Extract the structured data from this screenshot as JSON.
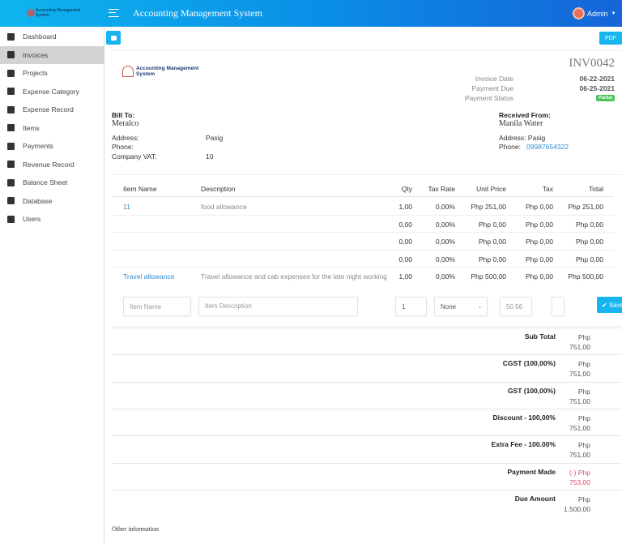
{
  "header": {
    "logo_text": "Accounting Management System",
    "title": "Accounting Management System",
    "user": "Admin"
  },
  "sidebar": {
    "items": [
      {
        "label": "Dashboard",
        "icon": "dashboard-icon"
      },
      {
        "label": "Invoices",
        "icon": "file-icon",
        "active": true
      },
      {
        "label": "Projects",
        "icon": "sitemap-icon"
      },
      {
        "label": "Expense Category",
        "icon": "search-dollar-icon"
      },
      {
        "label": "Expense Record",
        "icon": "file-invoice-icon"
      },
      {
        "label": "Items",
        "icon": "list-icon"
      },
      {
        "label": "Payments",
        "icon": "money-icon"
      },
      {
        "label": "Revenue Record",
        "icon": "filter-dollar-icon"
      },
      {
        "label": "Balance Sheet",
        "icon": "file-invoice-icon"
      },
      {
        "label": "Database",
        "icon": "database-icon"
      },
      {
        "label": "Users",
        "icon": "user-icon"
      }
    ]
  },
  "toolbar": {
    "print_icon": "print-icon",
    "pdf_label": "PDF"
  },
  "invoice": {
    "logo_text": "Accounting Management System",
    "number": "INV0042",
    "meta": [
      {
        "label": "Invoice Date",
        "value": "06-22-2021"
      },
      {
        "label": "Payment Due",
        "value": "06-25-2021"
      },
      {
        "label": "Payment Status",
        "value": "Partial"
      }
    ],
    "status_color": "#4cc45a",
    "bill_to": {
      "heading": "Bill To:",
      "name": "Meralco",
      "address_label": "Address:",
      "address": "Pasig",
      "phone_label": "Phone:",
      "phone": "",
      "vat_label": "Company VAT:",
      "vat": "10"
    },
    "received_from": {
      "heading": "Received From:",
      "name": "Manila Water",
      "address_label": "Address:",
      "address": "Pasig",
      "phone_label": "Phone:",
      "phone": "09987654322"
    },
    "columns": [
      "Item Name",
      "Description",
      "Qty",
      "Tax Rate",
      "Unit Price",
      "Tax",
      "Total"
    ],
    "rows": [
      [
        "11",
        "food allowance",
        "1,00",
        "0,00%",
        "Php 251,00",
        "Php 0,00",
        "Php 251,00"
      ],
      [
        "",
        "",
        "0,00",
        "0,00%",
        "Php 0,00",
        "Php 0,00",
        "Php 0,00"
      ],
      [
        "",
        "",
        "0,00",
        "0,00%",
        "Php 0,00",
        "Php 0,00",
        "Php 0,00"
      ],
      [
        "",
        "",
        "0,00",
        "0,00%",
        "Php 0,00",
        "Php 0,00",
        "Php 0,00"
      ],
      [
        "Travel allowance",
        "Travel allowance and cab expenses for the late night working",
        "1,00",
        "0,00%",
        "Php 500,00",
        "Php 0,00",
        "Php 500,00"
      ]
    ],
    "new_item": {
      "name_placeholder": "Item Name",
      "desc_placeholder": "Item Description",
      "qty": "1",
      "tax_select": "None",
      "price_placeholder": "50.56",
      "save_label": "Save"
    },
    "totals": [
      {
        "label": "Sub Total",
        "value": "Php 751,00"
      },
      {
        "label": "CGST (100,00%)",
        "value": "Php 751,00"
      },
      {
        "label": "GST (100,00%)",
        "value": "Php 751,00"
      },
      {
        "label": "Discount - 100,00%",
        "value": "Php 751,00"
      },
      {
        "label": "Extra Fee - 100.00%",
        "value": "Php 751,00"
      },
      {
        "label": "Payment Made",
        "value": "(-) Php 753,00",
        "color": "#e0506e"
      },
      {
        "label": "Due Amount",
        "value": "Php 1.500,00"
      }
    ],
    "other_info": "Other information"
  }
}
